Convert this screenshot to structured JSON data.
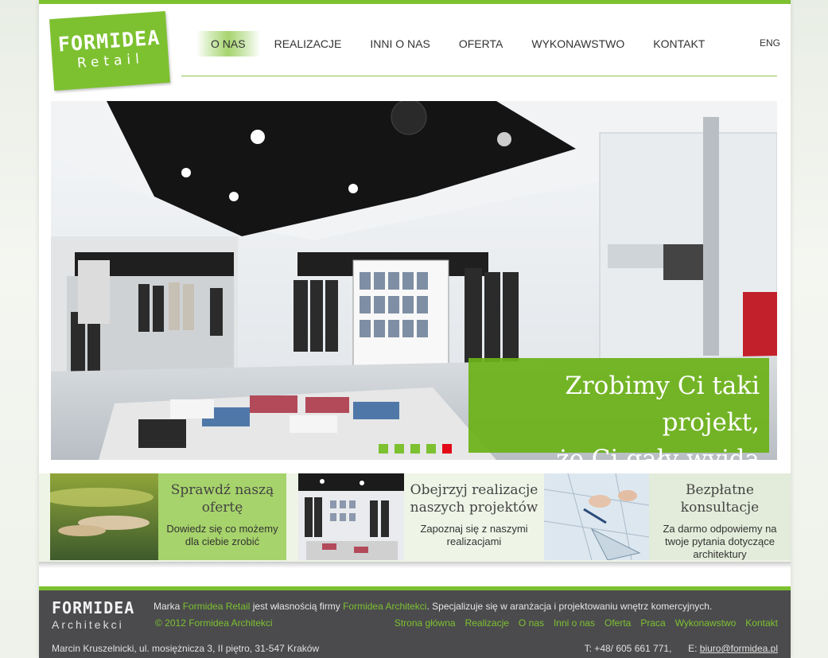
{
  "logo": {
    "line1": "FORMIDEA",
    "line2": "Retail"
  },
  "nav": {
    "items": [
      {
        "label": "O NAS",
        "active": true
      },
      {
        "label": "REALIZACJE"
      },
      {
        "label": "INNI O NAS"
      },
      {
        "label": "OFERTA"
      },
      {
        "label": "WYKONAWSTWO"
      },
      {
        "label": "KONTAKT"
      }
    ],
    "lang": "ENG"
  },
  "hero": {
    "caption_line1": "Zrobimy Ci taki projekt,",
    "caption_line2": "że Ci gały wyjdą",
    "slides_total": 5,
    "slide_active": 5
  },
  "promo": [
    {
      "title_line1": "Sprawdź naszą",
      "title_line2": "ofertę",
      "desc_line1": "Dowiedz się co możemy",
      "desc_line2": "dla ciebie zrobić"
    },
    {
      "title_line1": "Obejrzyj realizacje",
      "title_line2": "naszych projektów",
      "desc_line1": "Zapoznaj się z naszymi",
      "desc_line2": "realizacjami"
    },
    {
      "title_line1": "Bezpłatne",
      "title_line2": "konsultacje",
      "desc_line1": "Za darmo odpowiemy na",
      "desc_line2": "twoje pytania dotyczące",
      "desc_line3": "architektury"
    }
  ],
  "footer": {
    "logo_line1": "FORMIDEA",
    "logo_line2": "Architekci",
    "brand_text": {
      "pre": "Marka ",
      "brand": "Formidea Retail",
      "mid": " jest własnością firmy ",
      "company": "Formidea Architekci",
      "post": ". Specjalizuje się w aranżacja i projektowaniu wnętrz komercyjnych."
    },
    "copyright": "© 2012 Formidea Architekci",
    "nav": [
      "Strona główna",
      "Realizacje",
      "O nas",
      "Inni o nas",
      "Oferta",
      "Praca",
      "Wykonawstwo",
      "Kontakt"
    ],
    "address": "Marcin Kruszelnicki, ul. mosiężnicza 3, II piętro, 31-547 Kraków",
    "phone": "T: +48/ 605 661 771,",
    "email_label": "E: ",
    "email": "biuro@formidea.pl"
  },
  "colors": {
    "accent": "#7dc130",
    "footer_bg": "#4b4b4d",
    "active_dot": "#e20a16"
  }
}
